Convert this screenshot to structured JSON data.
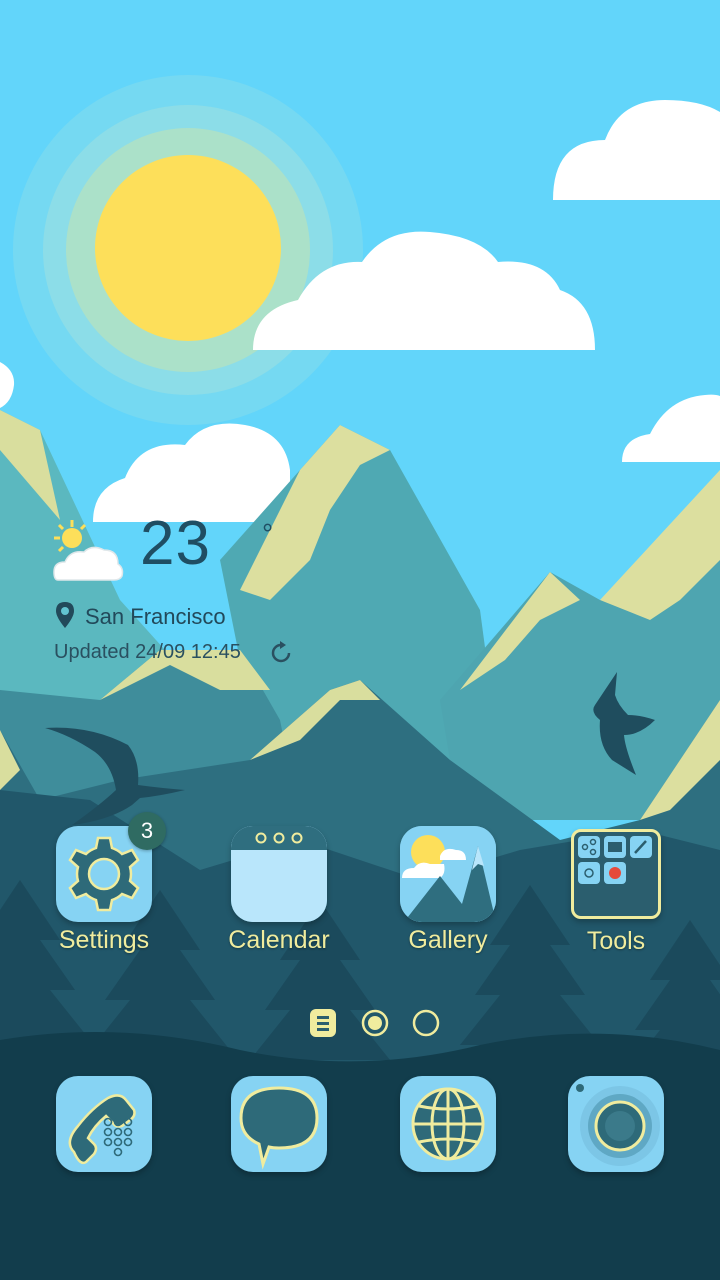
{
  "weather": {
    "temperature": "23",
    "degree_symbol": "°",
    "city": "San Francisco",
    "updated": "Updated 24/09 12:45",
    "icon": "partly-cloudy-icon"
  },
  "home_apps": [
    {
      "label": "Settings",
      "icon": "gear-icon",
      "badge": "3"
    },
    {
      "label": "Calendar",
      "icon": "calendar-icon"
    },
    {
      "label": "Gallery",
      "icon": "mountain-photo-icon"
    },
    {
      "label": "Tools",
      "icon": "folder-icon"
    }
  ],
  "page_indicator": {
    "pages": 2,
    "current": 1,
    "menu_icon": "apps-list-icon"
  },
  "dock": [
    {
      "icon": "phone-dialer-icon"
    },
    {
      "icon": "message-bubble-icon"
    },
    {
      "icon": "globe-browser-icon"
    },
    {
      "icon": "camera-lens-icon"
    }
  ],
  "colors": {
    "sky": "#5fd3f8",
    "sun": "#fde05a",
    "label_yellow": "#f0ec9e",
    "icon_tile": "#86d3f3",
    "dark_teal": "#123d4c"
  }
}
